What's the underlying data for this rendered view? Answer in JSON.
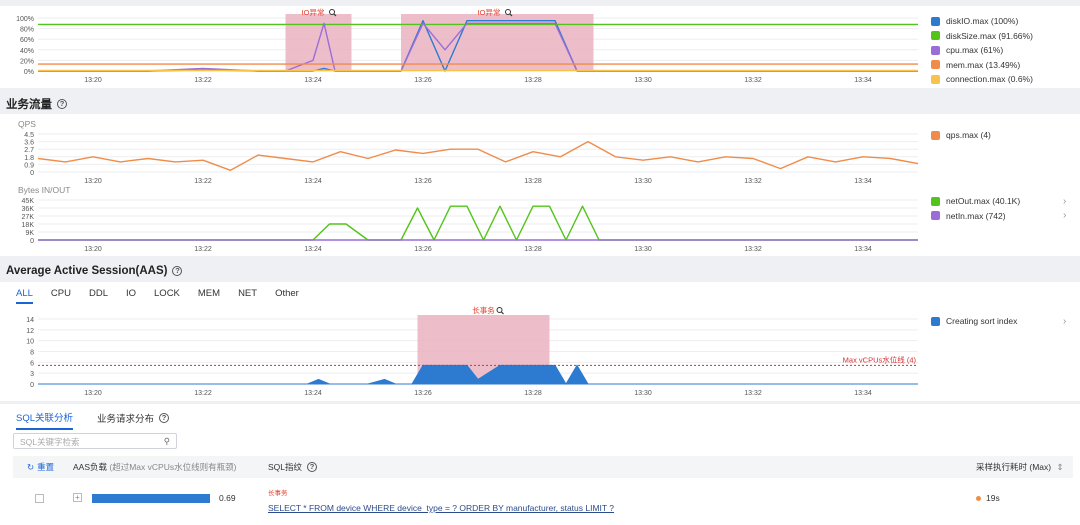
{
  "time_axis": {
    "ticks": [
      "13:20",
      "13:22",
      "13:24",
      "13:26",
      "13:28",
      "13:30",
      "13:32",
      "13:34"
    ]
  },
  "overview_chart": {
    "y_ticks": [
      "100%",
      "80%",
      "60%",
      "40%",
      "20%",
      "0%"
    ],
    "anomaly_label": "IO异常",
    "legend": [
      {
        "name": "diskIO.max (100%)",
        "color": "#2d7bd1"
      },
      {
        "name": "diskSize.max (91.66%)",
        "color": "#52c41a"
      },
      {
        "name": "cpu.max (61%)",
        "color": "#9b6dd6"
      },
      {
        "name": "mem.max (13.49%)",
        "color": "#f08c4a"
      },
      {
        "name": "connection.max (0.6%)",
        "color": "#f7c34a"
      }
    ]
  },
  "traffic_section": {
    "title": "业务流量",
    "qps_chart": {
      "label": "QPS",
      "y_ticks": [
        "4.5",
        "3.6",
        "2.7",
        "1.8",
        "0.9",
        "0"
      ],
      "legend": [
        {
          "name": "qps.max (4)",
          "color": "#f08c4a"
        }
      ]
    },
    "bytes_chart": {
      "label": "Bytes IN/OUT",
      "y_ticks": [
        "45K",
        "36K",
        "27K",
        "18K",
        "9K",
        "0"
      ],
      "legend": [
        {
          "name": "netOut.max (40.1K)",
          "color": "#52c41a"
        },
        {
          "name": "netIn.max (742)",
          "color": "#9b6dd6"
        }
      ]
    }
  },
  "aas_section": {
    "title": "Average Active Session(AAS)",
    "tabs": [
      "ALL",
      "CPU",
      "DDL",
      "IO",
      "LOCK",
      "MEM",
      "NET",
      "Other"
    ],
    "active_tab": "ALL",
    "chart": {
      "y_ticks": [
        "14",
        "12",
        "10",
        "8",
        "6",
        "3",
        "0"
      ],
      "anomaly_label": "长事务",
      "threshold_label": "Max vCPUs水位线 (4)",
      "legend": [
        {
          "name": "Creating sort index",
          "color": "#2d7bd1"
        }
      ]
    }
  },
  "analysis": {
    "tabs": [
      "SQL关联分析",
      "业务请求分布"
    ],
    "search_placeholder": "SQL关键字检索",
    "reset_label": "重置",
    "col_aas": "AAS负载",
    "col_aas_note": "(超过Max vCPUs水位线则有瓶颈)",
    "col_sql": "SQL指纹",
    "col_time": "采样执行耗时 (Max)",
    "rows": [
      {
        "aas_value": "0.69",
        "aas_fraction": 0.95,
        "tag": "长事务",
        "sql": "SELECT * FROM device WHERE device_type = ? ORDER BY manufacturer, status LIMIT ?",
        "time": "19s"
      }
    ]
  },
  "chart_data": [
    {
      "type": "line",
      "title": "",
      "x": [
        "13:19",
        "13:20",
        "13:21",
        "13:22",
        "13:23",
        "13:23.5",
        "13:24",
        "13:24.2",
        "13:24.4",
        "13:24.6",
        "13:25",
        "13:25.6",
        "13:26",
        "13:26.4",
        "13:26.8",
        "13:27.2",
        "13:27.6",
        "13:28",
        "13:28.4",
        "13:28.8",
        "13:29",
        "13:30",
        "13:31",
        "13:32",
        "13:33",
        "13:34",
        "13:35"
      ],
      "ylim": [
        0,
        100
      ],
      "series": [
        {
          "name": "diskIO.max (100%)",
          "values": [
            0,
            0,
            0,
            2,
            0,
            0,
            0,
            5,
            0,
            0,
            0,
            0,
            95,
            0,
            95,
            95,
            95,
            95,
            95,
            0,
            0,
            0,
            0,
            0,
            0,
            0,
            0
          ]
        },
        {
          "name": "diskSize.max (91.66%)",
          "values": [
            88,
            88,
            88,
            88,
            88,
            88,
            88,
            88,
            88,
            88,
            88,
            88,
            88,
            88,
            88,
            88,
            88,
            88,
            88,
            88,
            88,
            88,
            88,
            88,
            88,
            88,
            88
          ]
        },
        {
          "name": "cpu.max (61%)",
          "values": [
            0,
            0,
            0,
            5,
            0,
            0,
            20,
            90,
            0,
            0,
            0,
            0,
            90,
            40,
            90,
            90,
            90,
            90,
            90,
            0,
            0,
            0,
            0,
            0,
            0,
            0,
            0
          ]
        },
        {
          "name": "mem.max (13.49%)",
          "values": [
            13,
            13,
            13,
            13,
            13,
            13,
            13,
            13,
            13,
            13,
            13,
            13,
            13,
            13,
            13,
            13,
            13,
            13,
            13,
            13,
            13,
            13,
            13,
            13,
            13,
            13,
            13
          ]
        },
        {
          "name": "connection.max (0.6%)",
          "values": [
            1,
            1,
            1,
            1,
            1,
            1,
            1,
            1,
            1,
            1,
            1,
            1,
            1,
            1,
            1,
            1,
            1,
            1,
            1,
            1,
            1,
            1,
            1,
            1,
            1,
            1,
            1
          ]
        }
      ]
    },
    {
      "type": "line",
      "title": "",
      "ylabel": "QPS",
      "x": [
        "13:19",
        "13:19.5",
        "13:20",
        "13:20.5",
        "13:21",
        "13:21.5",
        "13:22",
        "13:22.5",
        "13:23",
        "13:23.5",
        "13:24",
        "13:24.5",
        "13:25",
        "13:25.5",
        "13:26",
        "13:26.5",
        "13:27",
        "13:27.5",
        "13:28",
        "13:28.5",
        "13:29",
        "13:29.5",
        "13:30",
        "13:30.5",
        "13:31",
        "13:31.5",
        "13:32",
        "13:32.5",
        "13:33",
        "13:33.5",
        "13:34",
        "13:34.5",
        "13:35"
      ],
      "ylim": [
        0,
        4.5
      ],
      "series": [
        {
          "name": "qps.max (4)",
          "values": [
            1.6,
            1.2,
            1.8,
            1.2,
            1.6,
            1.2,
            1.4,
            0.2,
            2.0,
            1.6,
            1.2,
            2.4,
            1.6,
            2.6,
            2.2,
            2.7,
            2.7,
            1.2,
            2.4,
            1.8,
            3.6,
            1.8,
            1.4,
            1.8,
            1.2,
            1.8,
            1.6,
            0.4,
            1.8,
            1.2,
            1.8,
            1.6,
            1.0
          ]
        }
      ]
    },
    {
      "type": "line",
      "title": "",
      "ylabel": "Bytes IN/OUT",
      "x": [
        "13:19",
        "13:20",
        "13:21",
        "13:22",
        "13:23",
        "13:24",
        "13:24.3",
        "13:24.6",
        "13:25",
        "13:25.6",
        "13:25.9",
        "13:26.2",
        "13:26.5",
        "13:26.8",
        "13:27.1",
        "13:27.4",
        "13:27.7",
        "13:28",
        "13:28.3",
        "13:28.6",
        "13:28.9",
        "13:29.2",
        "13:30",
        "13:31",
        "13:32",
        "13:33",
        "13:34",
        "13:35"
      ],
      "ylim": [
        0,
        45000
      ],
      "series": [
        {
          "name": "netOut.max (40.1K)",
          "values": [
            0,
            0,
            0,
            0,
            0,
            0,
            18000,
            18000,
            0,
            0,
            36000,
            0,
            38000,
            38000,
            0,
            38000,
            0,
            38000,
            38000,
            0,
            38000,
            0,
            0,
            0,
            0,
            0,
            0,
            0
          ]
        },
        {
          "name": "netIn.max (742)",
          "values": [
            0,
            0,
            0,
            0,
            0,
            0,
            0,
            0,
            0,
            0,
            0,
            0,
            0,
            0,
            0,
            0,
            0,
            0,
            0,
            0,
            0,
            0,
            0,
            0,
            0,
            0,
            0,
            0
          ]
        }
      ]
    },
    {
      "type": "area",
      "title": "",
      "x": [
        "13:19",
        "13:20",
        "13:21",
        "13:22",
        "13:23",
        "13:23.9",
        "13:24.1",
        "13:24.3",
        "13:25",
        "13:25.3",
        "13:25.5",
        "13:25.8",
        "13:26",
        "13:26.4",
        "13:26.8",
        "13:27",
        "13:27.4",
        "13:27.8",
        "13:28",
        "13:28.4",
        "13:28.6",
        "13:28.8",
        "13:29",
        "13:30",
        "13:31",
        "13:32",
        "13:33",
        "13:34",
        "13:35"
      ],
      "ylim": [
        0,
        14
      ],
      "threshold": 4,
      "series": [
        {
          "name": "Creating sort index",
          "values": [
            0,
            0,
            0,
            0,
            0,
            0,
            1,
            0,
            0,
            1,
            0,
            0,
            4,
            4,
            4,
            1,
            4,
            4,
            4,
            4,
            0,
            4,
            0,
            0,
            0,
            0,
            0,
            0,
            0
          ]
        }
      ]
    }
  ]
}
